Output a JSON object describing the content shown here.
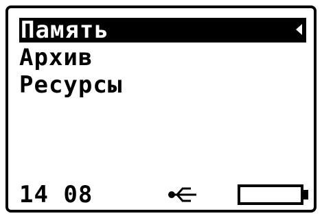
{
  "menu": {
    "items": [
      {
        "label": "Память",
        "selected": true
      },
      {
        "label": "Архив",
        "selected": false
      },
      {
        "label": "Ресурсы",
        "selected": false
      }
    ]
  },
  "status": {
    "time": "14 08",
    "usb_icon": "usb-icon",
    "battery_icon": "battery-icon",
    "battery_level": 0
  },
  "colors": {
    "background": "#ffffff",
    "foreground": "#000000"
  }
}
